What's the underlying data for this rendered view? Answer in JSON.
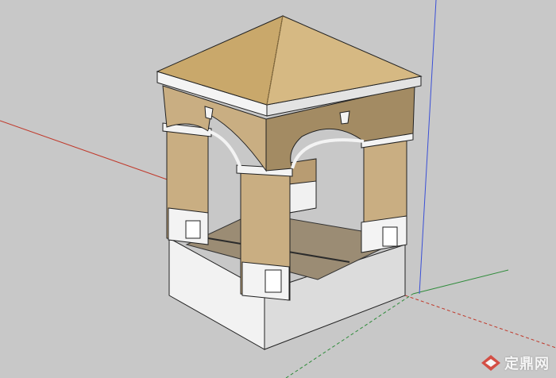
{
  "scene": {
    "description_visible": false,
    "background_color": "#c8c8c8",
    "axis_colors": {
      "red": "#c0392b",
      "green": "#2e8b3a",
      "blue": "#3a4fd6"
    },
    "model_colors": {
      "roof": "#c9a86b",
      "roof_dark": "#a88a55",
      "wall_light": "#c9ae82",
      "wall_dark": "#a38b63",
      "trim": "#f3f3f3",
      "base": "#ececec",
      "floor": "#9b8c74"
    }
  },
  "watermark": {
    "text": "定鼎网",
    "icon": "dingding-logo-icon"
  }
}
